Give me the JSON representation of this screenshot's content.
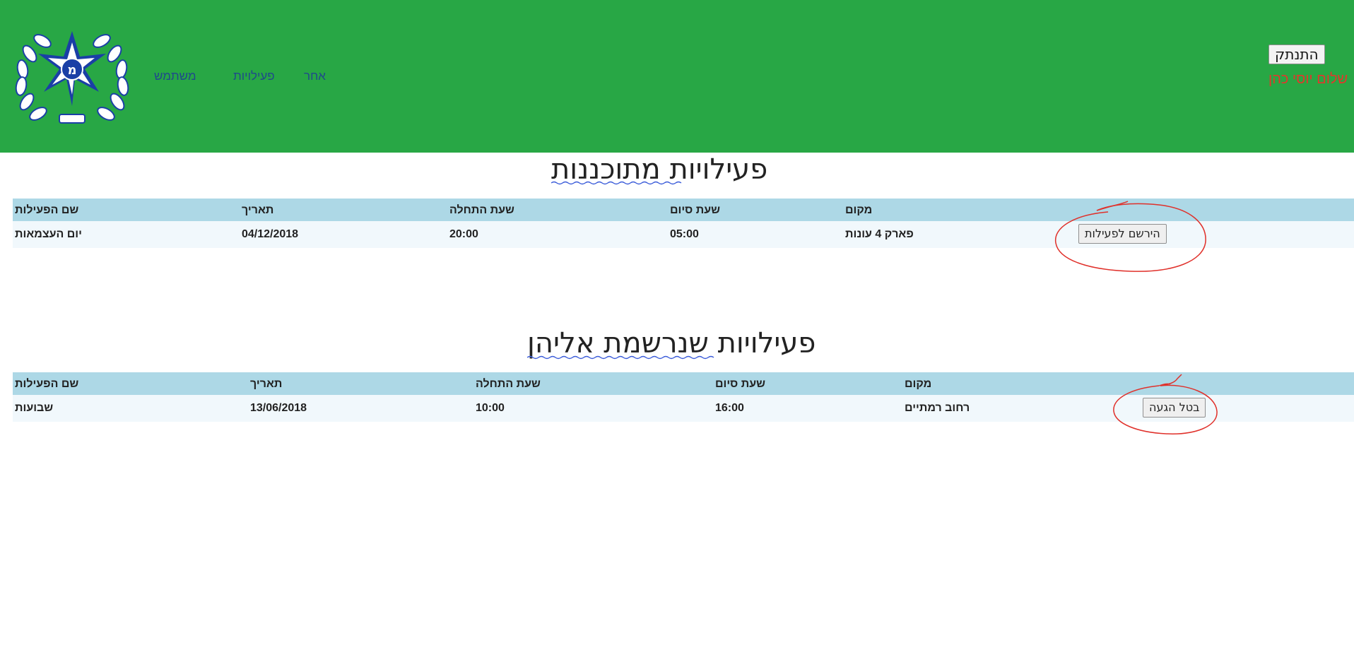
{
  "header": {
    "nav": {
      "other": "אחר",
      "activities": "פעילויות",
      "user": "משתמש"
    },
    "logout_label": "התנתק",
    "greeting": "שלום יוסי כהן",
    "logo_icon": "police-emblem-icon",
    "colors": {
      "background": "#28a745",
      "nav": "#1f4a8a",
      "greeting": "#e2372b"
    }
  },
  "planned": {
    "title": "פעילויות מתוכננות",
    "columns": {
      "name": "שם הפעילות",
      "date": "תאריך",
      "start": "שעת התחלה",
      "end": "שעת סיום",
      "location": "מקום"
    },
    "rows": [
      {
        "name": "יום העצמאות",
        "date": "04/12/2018",
        "start": "20:00",
        "end": "05:00",
        "location": "פארק 4 עונות",
        "action": "הירשם לפעילות"
      }
    ]
  },
  "registered": {
    "title": "פעילויות שנרשמת אליהן",
    "columns": {
      "name": "שם הפעילות",
      "date": "תאריך",
      "start": "שעת התחלה",
      "end": "שעת סיום",
      "location": "מקום"
    },
    "rows": [
      {
        "name": "שבועות",
        "date": "13/06/2018",
        "start": "10:00",
        "end": "16:00",
        "location": "רחוב רמתיים",
        "action": "בטל הגעה"
      }
    ]
  },
  "colors": {
    "table_header": "#add8e6",
    "table_row": "#f1f8fc",
    "annotation": "#e0302a",
    "spellcheck": "#3a5bd9"
  }
}
